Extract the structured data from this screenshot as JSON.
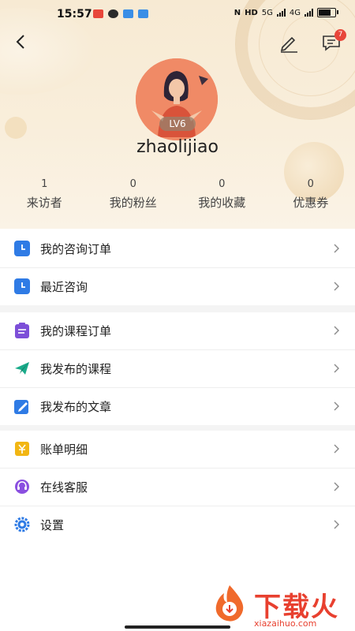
{
  "status_bar": {
    "time": "15:57",
    "network": "HD",
    "speed": "5G",
    "signal_label": "4G"
  },
  "nav": {
    "back_icon": "chevron-left-icon",
    "edit_icon": "pencil-icon",
    "messages_icon": "message-icon",
    "messages_badge": "7"
  },
  "profile": {
    "level": "LV6",
    "username": "zhaolijiao"
  },
  "stats": [
    {
      "value": "1",
      "label": "来访者"
    },
    {
      "value": "0",
      "label": "我的粉丝"
    },
    {
      "value": "0",
      "label": "我的收藏"
    },
    {
      "value": "0",
      "label": "优惠券"
    }
  ],
  "sections": {
    "consult": [
      {
        "label": "我的咨询订单",
        "icon": "clock-icon"
      },
      {
        "label": "最近咨询",
        "icon": "clock-icon"
      }
    ],
    "course": [
      {
        "label": "我的课程订单",
        "icon": "clipboard-icon"
      },
      {
        "label": "我发布的课程",
        "icon": "paper-plane-icon"
      },
      {
        "label": "我发布的文章",
        "icon": "edit-icon"
      }
    ],
    "account": [
      {
        "label": "账单明细",
        "icon": "yen-icon"
      },
      {
        "label": "在线客服",
        "icon": "headset-icon"
      },
      {
        "label": "设置",
        "icon": "gear-icon"
      }
    ]
  },
  "watermark": {
    "title": "下载火",
    "subtitle": "xiazaihuo.com"
  },
  "colors": {
    "header_bg": "#f7ead3",
    "accent_blue": "#2f7be5",
    "badge_red": "#e8463a",
    "brand_red": "#e8402f"
  }
}
